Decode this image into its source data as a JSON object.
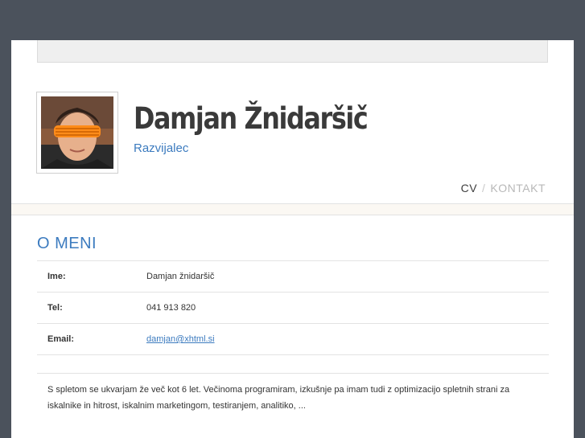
{
  "profile": {
    "name": "Damjan Žnidaršič",
    "role": "Razvijalec"
  },
  "nav": {
    "cv": "CV",
    "separator": "/",
    "contact": "KONTAKT"
  },
  "section": {
    "title": "O MENI"
  },
  "info": [
    {
      "label": "Ime:",
      "value": "Damjan žnidaršič"
    },
    {
      "label": "Tel:",
      "value": "041 913 820"
    },
    {
      "label": "Email:",
      "value": "damjan@xhtml.si"
    }
  ],
  "about": "S spletom se ukvarjam že več kot 6 let. Večinoma programiram, izkušnje pa imam tudi z optimizacijo spletnih strani za iskalnike in hitrost, iskalnim marketingom, testiranjem, analitiko, ...",
  "colors": {
    "background": "#4b525c",
    "accent": "#3c7bbf",
    "glasses": "#ff8c1a"
  }
}
